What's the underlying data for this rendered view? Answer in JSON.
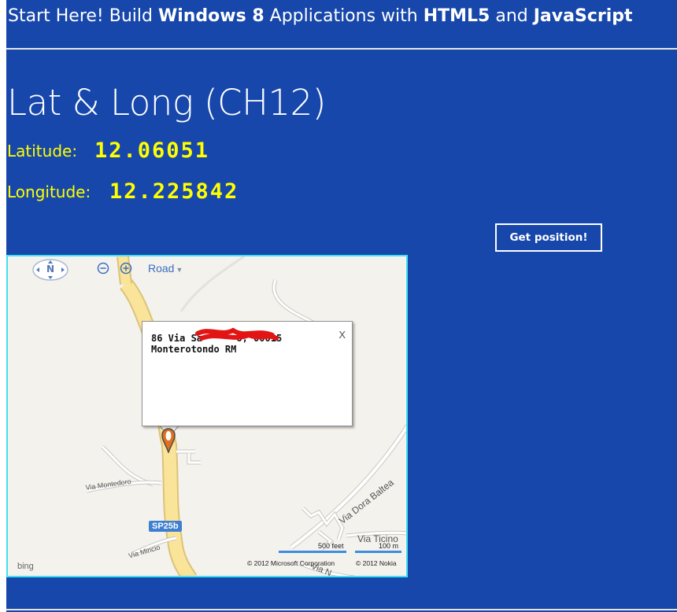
{
  "header": {
    "t1": "Start Here! Build ",
    "b1": "Windows 8",
    "t2": " Applications with ",
    "b2": "HTML5",
    "t3": " and ",
    "b3": "JavaScript"
  },
  "page_title": "Lat & Long (CH12)",
  "latitude": {
    "label": "Latitude:",
    "value": "12.06051"
  },
  "longitude": {
    "label": "Longitude:",
    "value": "12.225842"
  },
  "button": {
    "label": "Get position!"
  },
  "map": {
    "nav_label": "N",
    "map_type": "Road",
    "popup": {
      "line1": "86 Via Sa      o, 00015",
      "line2": "Monterotondo RM",
      "close": "X"
    },
    "streets": {
      "montedoro": "Via Montedoro",
      "mincio": "Via Mincio",
      "dora_baltea": "Via Dora Baltea",
      "ticino": "Via Ticino",
      "other": "Via N"
    },
    "road_shield": "SP25b",
    "bing": "bing",
    "scale_feet": "500 feet",
    "scale_m": "100 m",
    "copyright_ms": "© 2012 Microsoft Corporation",
    "copyright_nokia": "© 2012 Nokia",
    "colors": {
      "road_major": "#f9e49a",
      "road_major_edge": "#dcc37a",
      "road_minor": "#ffffff",
      "road_minor_edge": "#c9c7c0",
      "land": "#f4f2ed",
      "accent": "#43e0f0"
    }
  },
  "colors": {
    "background": "#1747ab",
    "header_text": "#ffffff",
    "value_text": "#ffff00"
  }
}
